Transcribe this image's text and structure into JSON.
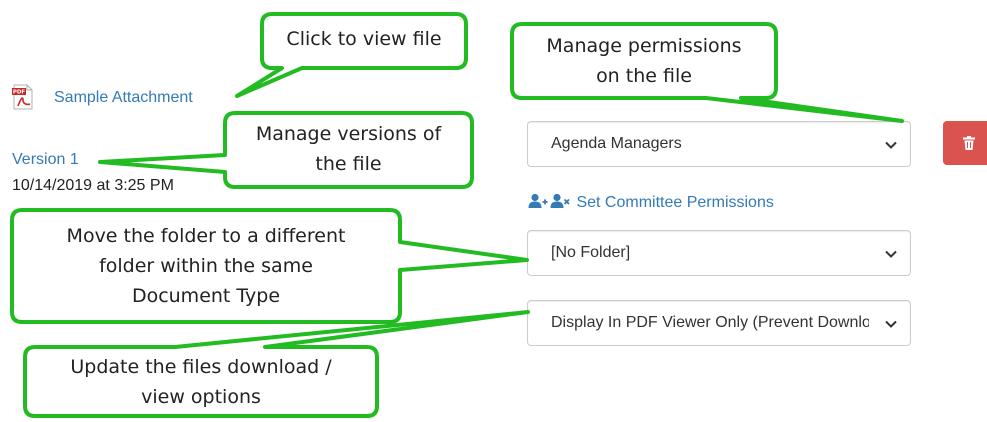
{
  "attachment": {
    "icon": "pdf-file-icon",
    "name": "Sample Attachment"
  },
  "version": {
    "label": "Version 1",
    "date": "10/14/2019 at 3:25 PM"
  },
  "permissions": {
    "selected": "Agenda Managers",
    "set_committee_label": "Set Committee Permissions",
    "icons": [
      "add-user-icon",
      "remove-user-icon"
    ]
  },
  "folder": {
    "selected": "[No Folder]"
  },
  "download_options": {
    "selected": "Display In PDF Viewer Only (Prevent Download)"
  },
  "delete_button": {
    "icon": "trash-icon",
    "color": "#d9534f"
  },
  "callouts": {
    "view_file": "Click to view file",
    "permissions_line1": "Manage permissions",
    "permissions_line2": "on the file",
    "versions_line1": "Manage versions of",
    "versions_line2": "the file",
    "move_line1": "Move the folder to a different",
    "move_line2": "folder within the same",
    "move_line3": "Document Type",
    "download_line1": "Update the files download /",
    "download_line2": "view options",
    "border_color": "#22bb22"
  },
  "colors": {
    "link": "#337ab7",
    "text": "#333333"
  }
}
